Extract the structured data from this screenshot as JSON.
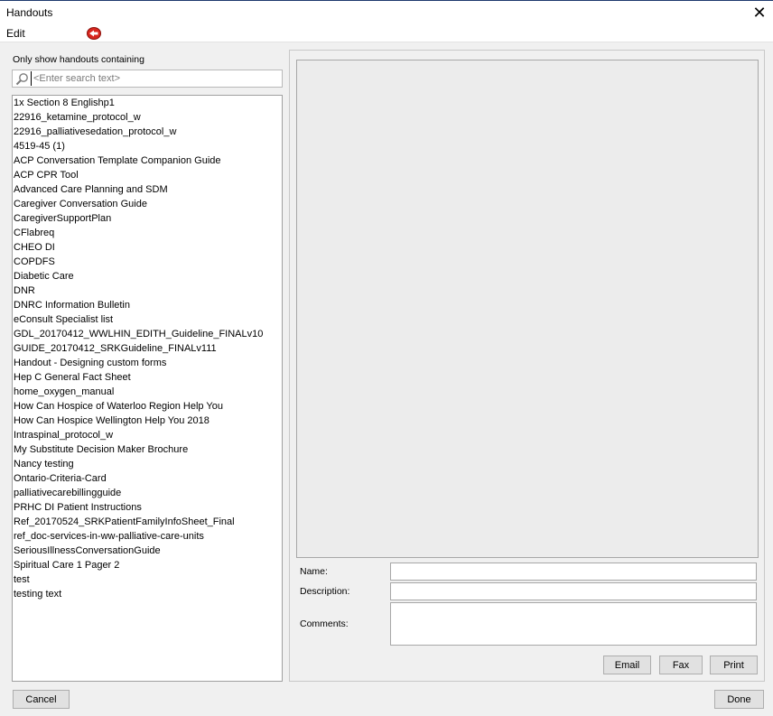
{
  "window": {
    "title": "Handouts",
    "close_glyph": "✕"
  },
  "menu": {
    "edit_label": "Edit",
    "icon": "red-arrow-icon"
  },
  "search": {
    "caption": "Only show handouts containing",
    "placeholder": "<Enter search text>",
    "value": ""
  },
  "handouts": [
    "1x Section 8 Englishp1",
    "22916_ketamine_protocol_w",
    "22916_palliativesedation_protocol_w",
    "4519-45 (1)",
    "ACP Conversation Template Companion Guide",
    "ACP CPR Tool",
    "Advanced Care Planning and SDM",
    "Caregiver Conversation Guide",
    "CaregiverSupportPlan",
    "CFlabreq",
    "CHEO DI",
    "COPDFS",
    "Diabetic Care",
    "DNR",
    "DNRC Information Bulletin",
    "eConsult Specialist list",
    "GDL_20170412_WWLHIN_EDITH_Guideline_FINALv10",
    "GUIDE_20170412_SRKGuideline_FINALv111",
    "Handout - Designing custom forms",
    "Hep C General Fact Sheet",
    "home_oxygen_manual",
    "How Can Hospice of Waterloo  Region Help You",
    "How Can Hospice Wellington Help You 2018",
    "Intraspinal_protocol_w",
    "My Substitute Decision Maker Brochure",
    "Nancy testing",
    "Ontario-Criteria-Card",
    "palliativecarebillingguide",
    "PRHC DI Patient Instructions",
    "Ref_20170524_SRKPatientFamilyInfoSheet_Final",
    "ref_doc-services-in-ww-palliative-care-units",
    "SeriousIllnessConversationGuide",
    "Spiritual Care 1 Pager 2",
    "test",
    "testing text"
  ],
  "details": {
    "name_label": "Name:",
    "name_value": "",
    "description_label": "Description:",
    "description_value": "",
    "comments_label": "Comments:",
    "comments_value": ""
  },
  "actions": {
    "email": "Email",
    "fax": "Fax",
    "print": "Print",
    "cancel": "Cancel",
    "done": "Done"
  }
}
